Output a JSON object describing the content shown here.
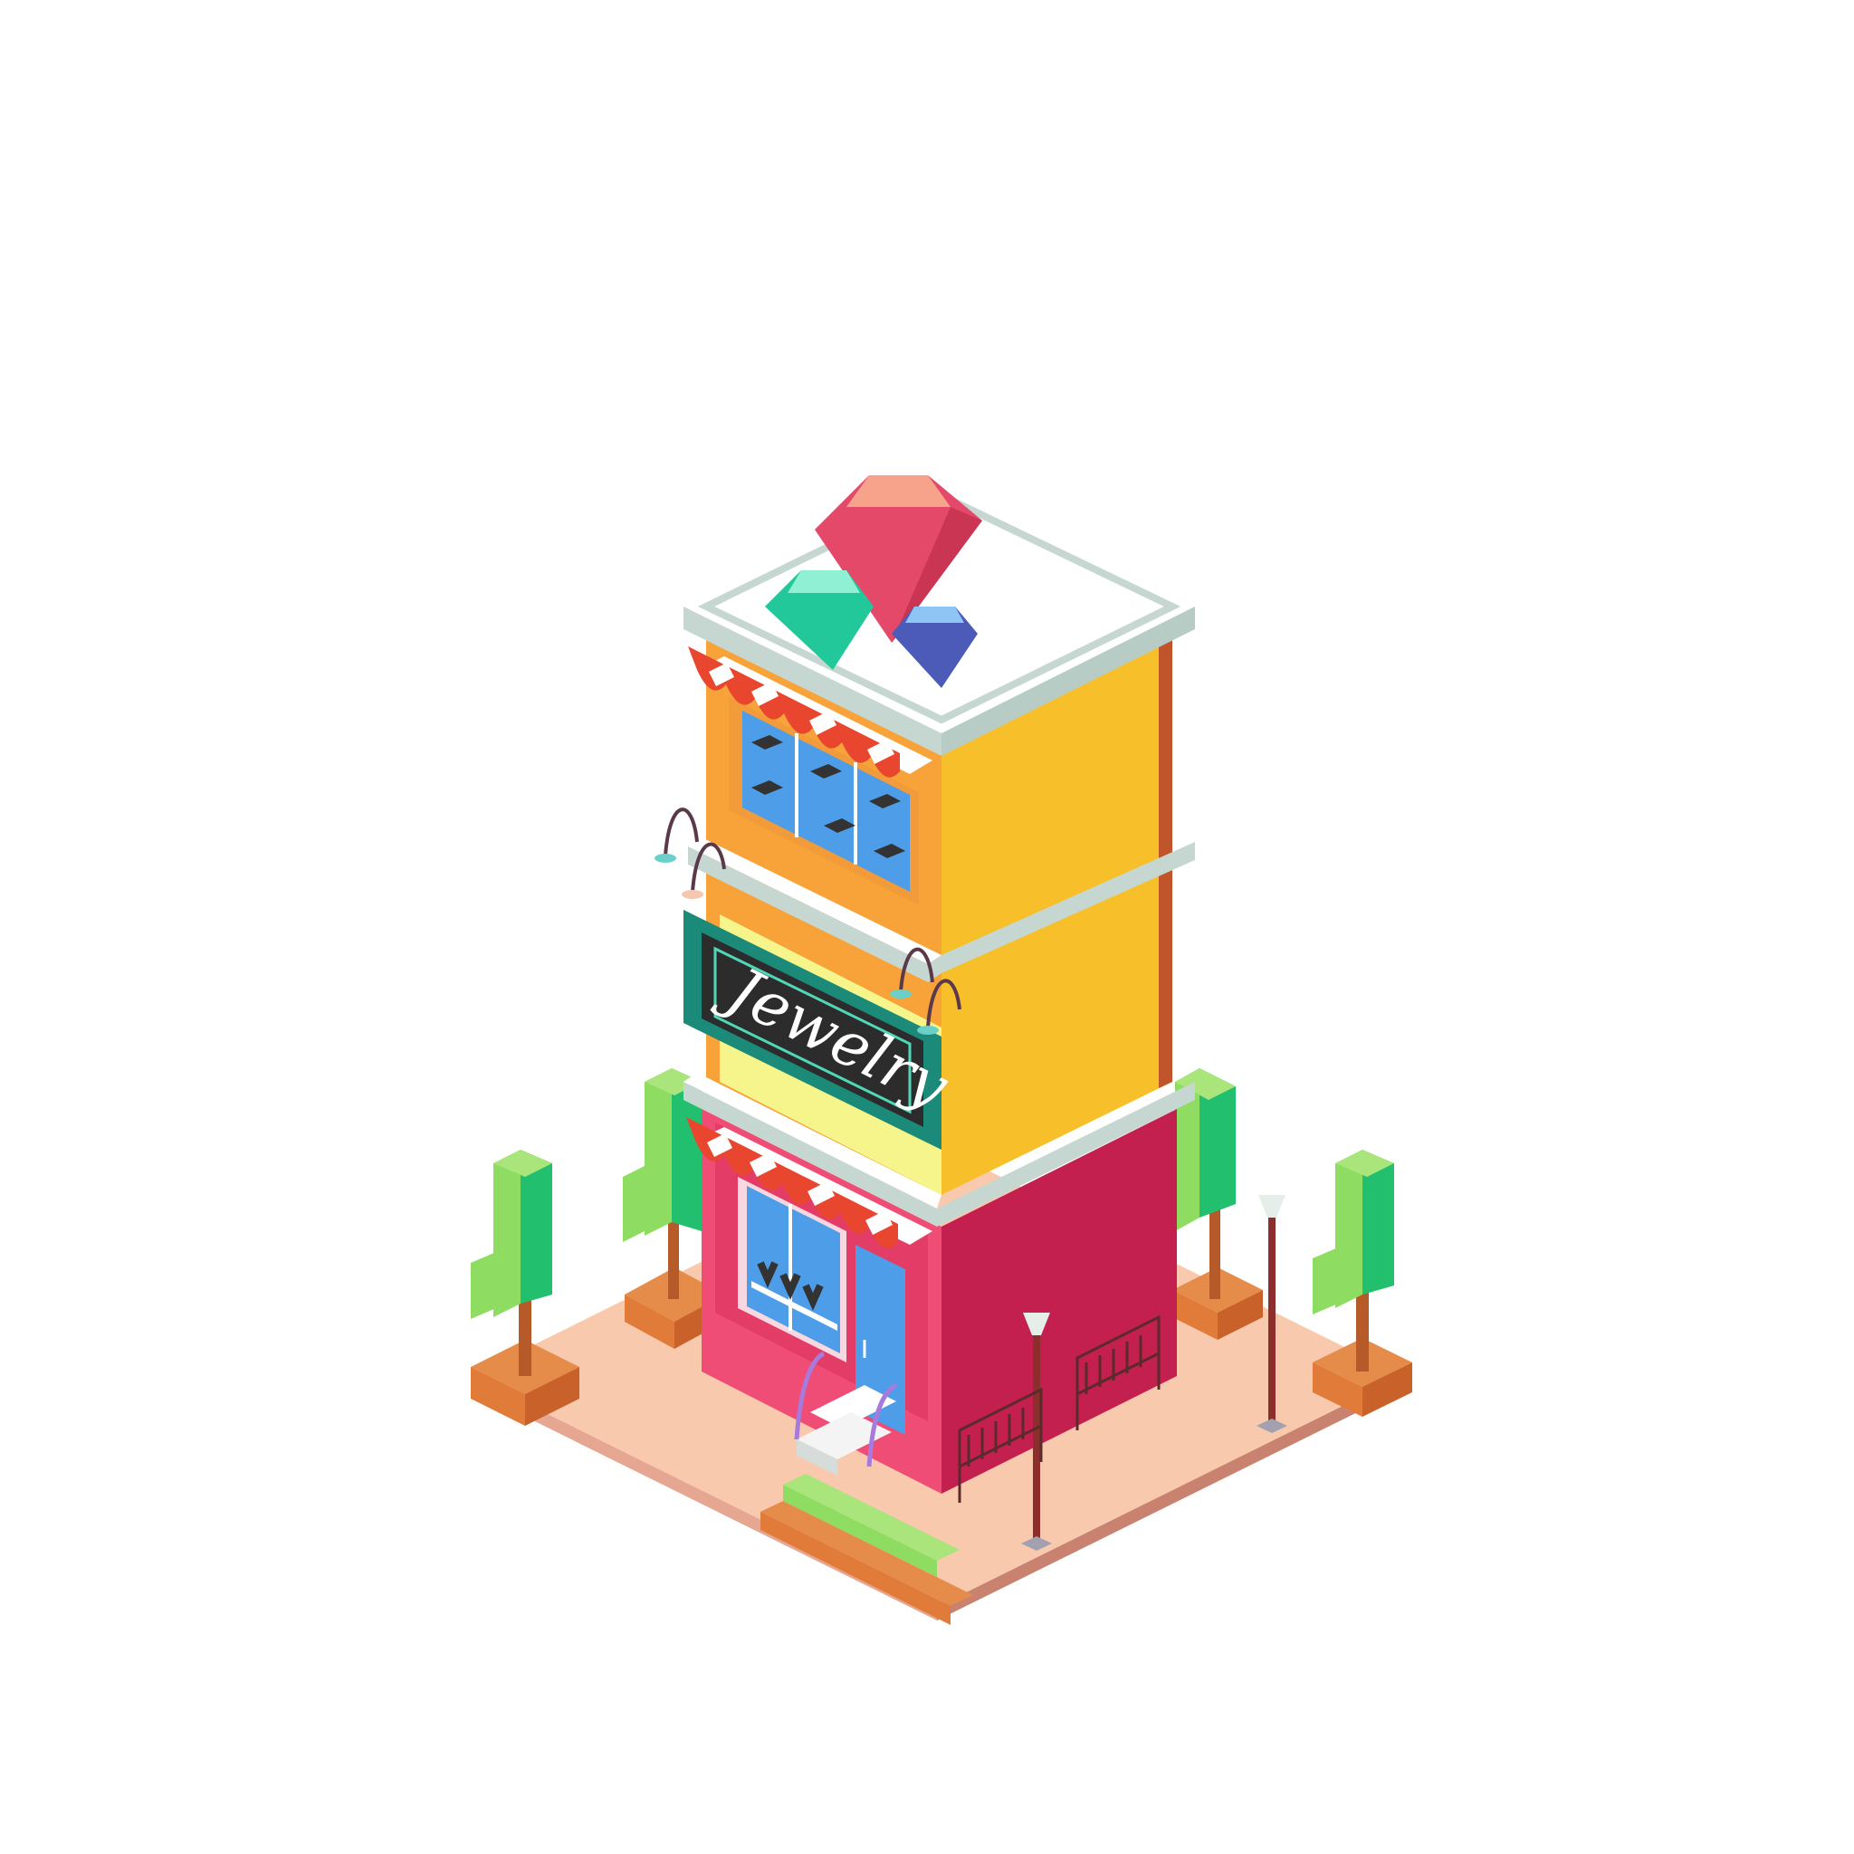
{
  "sign": {
    "text": "Jewelry"
  },
  "colors": {
    "background": "#ffffff",
    "plaza": "#f9c9ae",
    "plaza_edge_left": "#e6a792",
    "plaza_edge_right": "#c9826f",
    "upper_left": "#f7a33a",
    "upper_right": "#f7c02b",
    "upper_band": "#f6f58c",
    "lower_left": "#ef4c76",
    "lower_right": "#c31f4f",
    "roof": "#ffffff",
    "rim": "#c6d7d1",
    "awning_red": "#e8462f",
    "window_blue": "#4d9de8",
    "sign_frame": "#1b8a78",
    "sign_board": "#2c2c2c",
    "sign_text": "#ffffff",
    "gem_red": "#e5496a",
    "gem_teal": "#22c79a",
    "gem_blue": "#4b5bb7",
    "tree_green": "#22c06e",
    "tree_light": "#8fdc62",
    "planter": "#e07b3a",
    "lamp_post": "#8b2e2c",
    "bench": "#5a2a2d"
  }
}
